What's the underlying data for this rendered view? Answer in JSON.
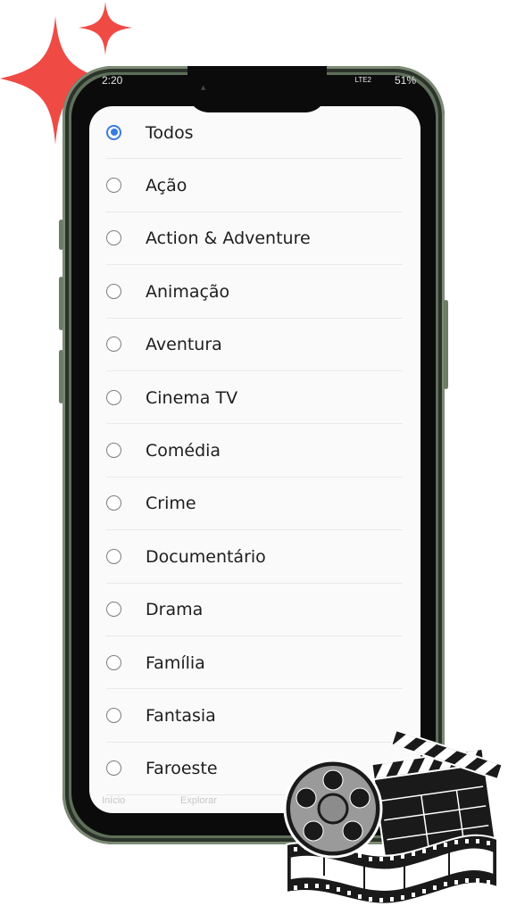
{
  "colors": {
    "accent": "#3b7be0",
    "sparkle": "#f04a45",
    "phone_frame": "#5f6f5a"
  },
  "status_bar": {
    "time": "2:20",
    "network": "LTE2",
    "battery": "51%"
  },
  "genres": {
    "selected": "Todos",
    "options": [
      "Todos",
      "Ação",
      "Action & Adventure",
      "Animação",
      "Aventura",
      "Cinema TV",
      "Comédia",
      "Crime",
      "Documentário",
      "Drama",
      "Família",
      "Fantasia",
      "Faroeste"
    ]
  },
  "bottom_nav": {
    "item1": "Início",
    "item2": "Explorar"
  },
  "decorations": {
    "top_left": "sparkle-icon",
    "bottom_right": "film-reel-clapperboard-icon"
  }
}
